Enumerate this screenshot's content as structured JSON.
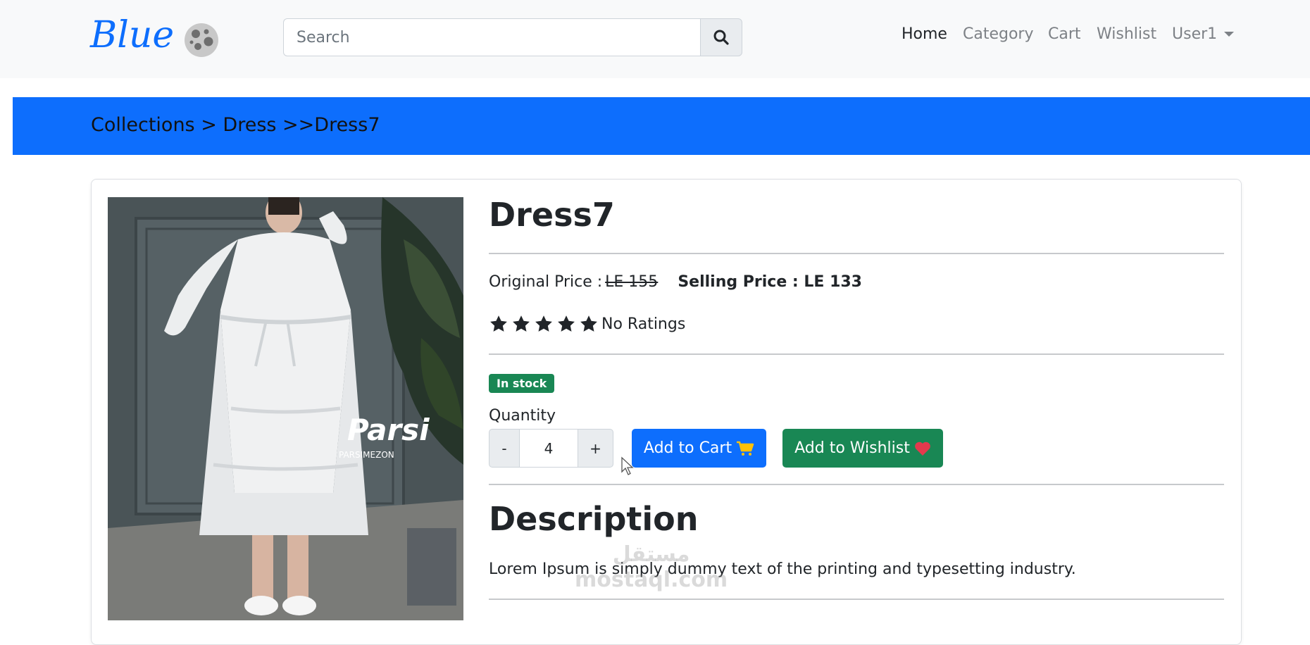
{
  "navbar": {
    "brand": "Blue",
    "search_placeholder": "Search",
    "links": [
      {
        "label": "Home",
        "active": true
      },
      {
        "label": "Category",
        "active": false
      },
      {
        "label": "Cart",
        "active": false
      },
      {
        "label": "Wishlist",
        "active": false
      }
    ],
    "user_menu": "User1"
  },
  "breadcrumb": "Collections > Dress >>Dress7",
  "product": {
    "name": "Dress7",
    "original_price_label": "Original Price :",
    "original_price": "LE 155",
    "selling_price": "Selling Price : LE 133",
    "rating_stars": 5,
    "rating_text": "No Ratings",
    "stock_badge": "In stock",
    "quantity_label": "Quantity",
    "quantity_value": "4",
    "minus_label": "-",
    "plus_label": "+",
    "add_to_cart_label": "Add to Cart",
    "add_to_wishlist_label": "Add to Wishlist",
    "image_watermark": "Parsi",
    "image_watermark_sub": "PARSIMEZON"
  },
  "description": {
    "heading": "Description",
    "text": "Lorem Ipsum is simply dummy text of the printing and typesetting industry."
  },
  "site_watermark": {
    "arabic": "مستقل",
    "latin": "mostaql.com"
  },
  "colors": {
    "primary": "#0d6efd",
    "success": "#198754",
    "navbar_bg": "#f8f9fa"
  },
  "icons": [
    "search-icon",
    "moon-logo-icon",
    "star-icon",
    "cart-icon",
    "heart-icon",
    "chevron-down-icon",
    "mouse-cursor-icon"
  ]
}
